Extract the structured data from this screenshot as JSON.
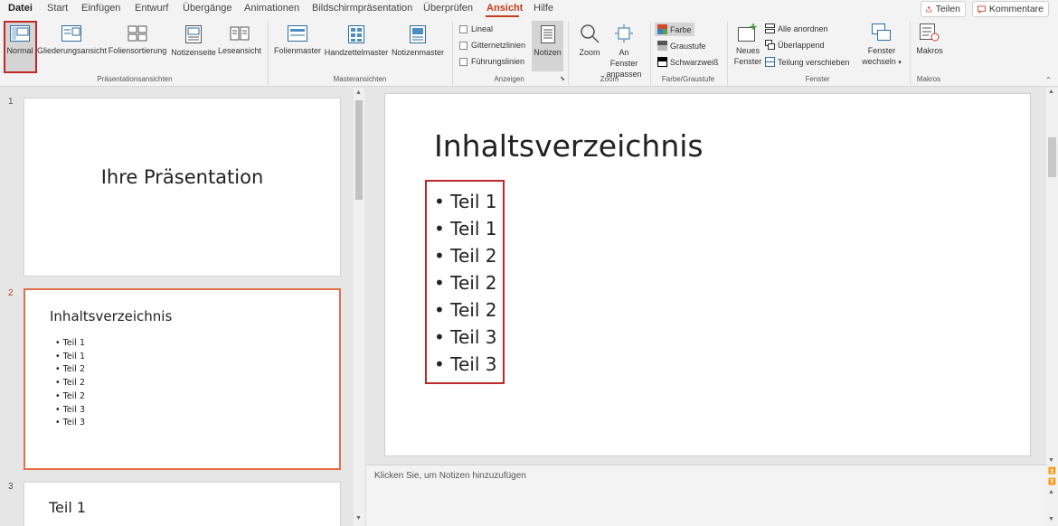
{
  "tabs": {
    "datei": "Datei",
    "start": "Start",
    "einfuegen": "Einfügen",
    "entwurf": "Entwurf",
    "uebergaenge": "Übergänge",
    "animationen": "Animationen",
    "bildschirm": "Bildschirmpräsentation",
    "ueberpruefen": "Überprüfen",
    "ansicht": "Ansicht",
    "hilfe": "Hilfe"
  },
  "share": {
    "label": "Teilen"
  },
  "comments": {
    "label": "Kommentare"
  },
  "ribbon": {
    "normal": "Normal",
    "gliederung": "Gliederungsansicht",
    "foliensortierung": "Foliensortierung",
    "notizenseite": "Notizenseite",
    "leseansicht": "Leseansicht",
    "group_praes": "Präsentationsansichten",
    "folienmaster": "Folienmaster",
    "handzettelmaster": "Handzettelmaster",
    "notizenmaster": "Notizenmaster",
    "group_master": "Masteransichten",
    "lineal": "Lineal",
    "gitternetz": "Gitternetzlinien",
    "fuehrung": "Führungslinien",
    "notizen": "Notizen",
    "group_anzeigen": "Anzeigen",
    "zoom": "Zoom",
    "fenster_anpassen_1": "An Fenster",
    "fenster_anpassen_2": "anpassen",
    "group_zoom": "Zoom",
    "farbe": "Farbe",
    "graustufe": "Graustufe",
    "schwarzweiss": "Schwarzweiß",
    "group_farbe": "Farbe/Graustufe",
    "neues_fenster_1": "Neues",
    "neues_fenster_2": "Fenster",
    "alle_anordnen": "Alle anordnen",
    "ueberlappend": "Überlappend",
    "teilung": "Teilung verschieben",
    "group_fenster": "Fenster",
    "fenster_wechseln_1": "Fenster",
    "fenster_wechseln_2": "wechseln",
    "makros": "Makros",
    "group_makros": "Makros"
  },
  "thumbnails": [
    {
      "number": "1",
      "title": "Ihre Präsentation"
    },
    {
      "number": "2",
      "title": "Inhaltsverzeichnis",
      "items": [
        "• Teil 1",
        "• Teil 1",
        "• Teil 2",
        "• Teil 2",
        "• Teil 2",
        "• Teil 3",
        "• Teil 3"
      ]
    },
    {
      "number": "3",
      "title": "Teil 1"
    }
  ],
  "slide": {
    "title": "Inhaltsverzeichnis",
    "items": [
      "• Teil 1",
      "• Teil 1",
      "• Teil 2",
      "• Teil 2",
      "• Teil 2",
      "• Teil 3",
      "• Teil 3"
    ]
  },
  "notes": {
    "placeholder": "Klicken Sie, um Notizen hinzuzufügen"
  },
  "colors": {
    "accent": "#c43e1c",
    "highlight": "#c0282a"
  }
}
